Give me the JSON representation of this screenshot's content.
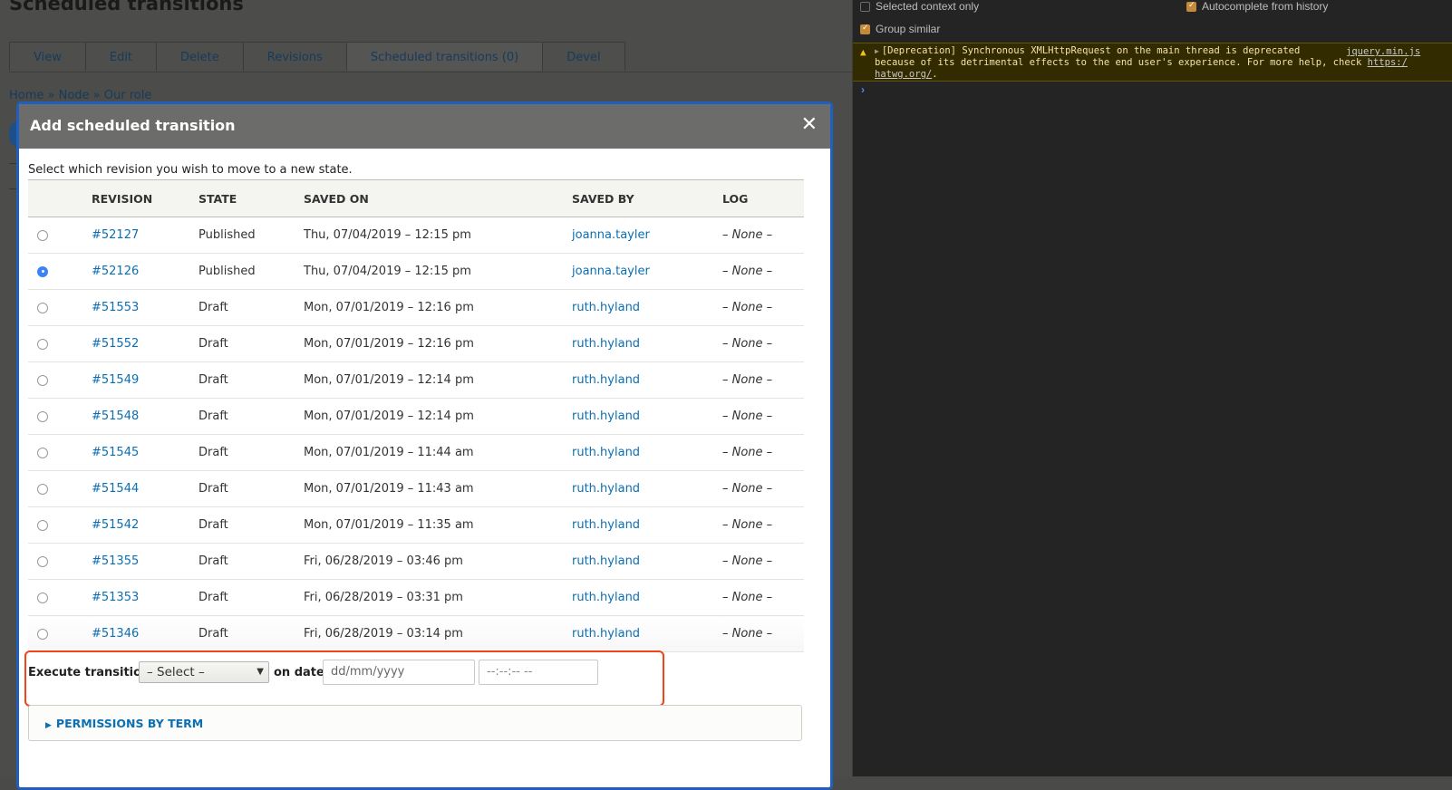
{
  "page": {
    "title": "Scheduled transitions",
    "tabs": [
      {
        "label": "View",
        "active": false
      },
      {
        "label": "Edit",
        "active": false
      },
      {
        "label": "Delete",
        "active": false
      },
      {
        "label": "Revisions",
        "active": false
      },
      {
        "label": "Scheduled transitions (0)",
        "active": true
      },
      {
        "label": "Devel",
        "active": false
      }
    ],
    "breadcrumb": "Home » Node » Our role"
  },
  "modal": {
    "title": "Add scheduled transition",
    "close_icon": "close-icon",
    "intro": "Select which revision you wish to move to a new state.",
    "columns": [
      "REVISION",
      "STATE",
      "SAVED ON",
      "SAVED BY",
      "LOG"
    ],
    "rows": [
      {
        "selected": false,
        "revision": "#52127",
        "state": "Published",
        "saved_on": "Thu, 07/04/2019 – 12:15 pm",
        "saved_by": "joanna.tayler",
        "log": "– None –"
      },
      {
        "selected": true,
        "revision": "#52126",
        "state": "Published",
        "saved_on": "Thu, 07/04/2019 – 12:15 pm",
        "saved_by": "joanna.tayler",
        "log": "– None –"
      },
      {
        "selected": false,
        "revision": "#51553",
        "state": "Draft",
        "saved_on": "Mon, 07/01/2019 – 12:16 pm",
        "saved_by": "ruth.hyland",
        "log": "– None –"
      },
      {
        "selected": false,
        "revision": "#51552",
        "state": "Draft",
        "saved_on": "Mon, 07/01/2019 – 12:16 pm",
        "saved_by": "ruth.hyland",
        "log": "– None –"
      },
      {
        "selected": false,
        "revision": "#51549",
        "state": "Draft",
        "saved_on": "Mon, 07/01/2019 – 12:14 pm",
        "saved_by": "ruth.hyland",
        "log": "– None –"
      },
      {
        "selected": false,
        "revision": "#51548",
        "state": "Draft",
        "saved_on": "Mon, 07/01/2019 – 12:14 pm",
        "saved_by": "ruth.hyland",
        "log": "– None –"
      },
      {
        "selected": false,
        "revision": "#51545",
        "state": "Draft",
        "saved_on": "Mon, 07/01/2019 – 11:44 am",
        "saved_by": "ruth.hyland",
        "log": "– None –"
      },
      {
        "selected": false,
        "revision": "#51544",
        "state": "Draft",
        "saved_on": "Mon, 07/01/2019 – 11:43 am",
        "saved_by": "ruth.hyland",
        "log": "– None –"
      },
      {
        "selected": false,
        "revision": "#51542",
        "state": "Draft",
        "saved_on": "Mon, 07/01/2019 – 11:35 am",
        "saved_by": "ruth.hyland",
        "log": "– None –"
      },
      {
        "selected": false,
        "revision": "#51355",
        "state": "Draft",
        "saved_on": "Fri, 06/28/2019 – 03:46 pm",
        "saved_by": "ruth.hyland",
        "log": "– None –"
      },
      {
        "selected": false,
        "revision": "#51353",
        "state": "Draft",
        "saved_on": "Fri, 06/28/2019 – 03:31 pm",
        "saved_by": "ruth.hyland",
        "log": "– None –"
      },
      {
        "selected": false,
        "revision": "#51346",
        "state": "Draft",
        "saved_on": "Fri, 06/28/2019 – 03:14 pm",
        "saved_by": "ruth.hyland",
        "log": "– None –"
      }
    ],
    "execute": {
      "label": "Execute transition",
      "select_value": "– Select –",
      "on_date_label": "on date",
      "date_placeholder": "dd/mm/yyyy",
      "time_placeholder": "--:--:-- --",
      "highlight_color": "#f0441a"
    },
    "details_summary": "PERMISSIONS BY TERM"
  },
  "devtools": {
    "options": [
      {
        "label": "Selected context only",
        "checked": false
      },
      {
        "label": "Autocomplete from history",
        "checked": true
      },
      {
        "label": "Group similar",
        "checked": true
      }
    ],
    "warning": {
      "line1": "[Deprecation] Synchronous XMLHttpRequest on the main thread is deprecated",
      "line2_text": "because of its detrimental effects to the end user's experience. For more help, check ",
      "line2_link": "https:/",
      "line3_link": "hatwg.org/",
      "line3_tail": ".",
      "source": "jquery.min.js"
    },
    "prompt": "›"
  }
}
